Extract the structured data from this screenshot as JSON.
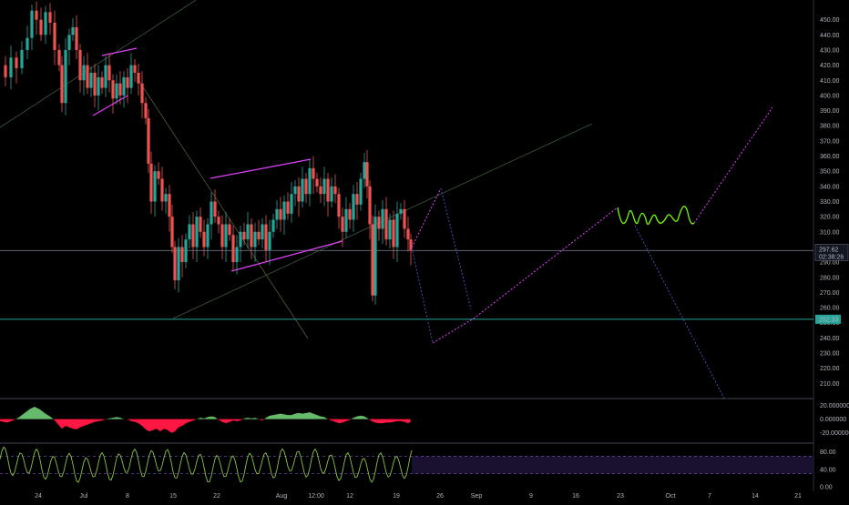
{
  "chart_data": [
    {
      "type": "candlestick",
      "pane": "price",
      "ylim": [
        200,
        457
      ],
      "y_ticks": [
        "450.00",
        "440.00",
        "430.00",
        "420.00",
        "410.00",
        "400.00",
        "390.00",
        "380.00",
        "370.00",
        "360.00",
        "350.00",
        "340.00",
        "330.00",
        "320.00",
        "310.00",
        "300.00",
        "290.00",
        "280.00",
        "270.00",
        "260.00",
        "250.00",
        "240.00",
        "230.00",
        "220.00",
        "210.00"
      ],
      "x_ticks": [
        "24",
        "Jul",
        "8",
        "15",
        "22",
        "Aug",
        "12:00",
        "12",
        "19",
        "26",
        "Sep",
        "9",
        "16",
        "23",
        "Oct",
        "7",
        "14",
        "21"
      ],
      "current_price": "297.62",
      "countdown": "02:38:26",
      "support_level": "252.33",
      "colors": {
        "up": "#26a69a",
        "down": "#ef5350",
        "background": "#000000",
        "fib_magenta": "#e040fb",
        "projection_blue": "#3f51b5",
        "support_line": "#26a69a",
        "wave_green": "#76ff03"
      },
      "price_path": [
        [
          0,
          420
        ],
        [
          6,
          412
        ],
        [
          12,
          425
        ],
        [
          18,
          418
        ],
        [
          24,
          430
        ],
        [
          30,
          438
        ],
        [
          35,
          456
        ],
        [
          40,
          450
        ],
        [
          45,
          440
        ],
        [
          50,
          455
        ],
        [
          55,
          448
        ],
        [
          60,
          430
        ],
        [
          65,
          420
        ],
        [
          68,
          395
        ],
        [
          72,
          430
        ],
        [
          76,
          440
        ],
        [
          80,
          445
        ],
        [
          84,
          430
        ],
        [
          88,
          410
        ],
        [
          92,
          420
        ],
        [
          96,
          405
        ],
        [
          100,
          415
        ],
        [
          104,
          400
        ],
        [
          108,
          412
        ],
        [
          112,
          405
        ],
        [
          116,
          420
        ],
        [
          120,
          410
        ],
        [
          124,
          398
        ],
        [
          128,
          408
        ],
        [
          132,
          400
        ],
        [
          136,
          412
        ],
        [
          140,
          405
        ],
        [
          144,
          420
        ],
        [
          148,
          415
        ],
        [
          152,
          408
        ],
        [
          156,
          395
        ],
        [
          160,
          385
        ],
        [
          163,
          355
        ],
        [
          166,
          330
        ],
        [
          170,
          350
        ],
        [
          174,
          345
        ],
        [
          178,
          330
        ],
        [
          182,
          335
        ],
        [
          186,
          320
        ],
        [
          189,
          300
        ],
        [
          192,
          278
        ],
        [
          196,
          300
        ],
        [
          200,
          290
        ],
        [
          204,
          305
        ],
        [
          208,
          315
        ],
        [
          212,
          300
        ],
        [
          216,
          320
        ],
        [
          220,
          310
        ],
        [
          224,
          300
        ],
        [
          228,
          315
        ],
        [
          232,
          330
        ],
        [
          236,
          320
        ],
        [
          240,
          315
        ],
        [
          244,
          300
        ],
        [
          248,
          315
        ],
        [
          252,
          308
        ],
        [
          256,
          290
        ],
        [
          260,
          300
        ],
        [
          264,
          310
        ],
        [
          268,
          305
        ],
        [
          272,
          315
        ],
        [
          276,
          300
        ],
        [
          280,
          310
        ],
        [
          284,
          305
        ],
        [
          288,
          315
        ],
        [
          292,
          298
        ],
        [
          296,
          310
        ],
        [
          300,
          318
        ],
        [
          304,
          325
        ],
        [
          308,
          318
        ],
        [
          312,
          330
        ],
        [
          316,
          322
        ],
        [
          320,
          335
        ],
        [
          324,
          340
        ],
        [
          328,
          330
        ],
        [
          332,
          345
        ],
        [
          336,
          335
        ],
        [
          340,
          352
        ],
        [
          344,
          345
        ],
        [
          348,
          340
        ],
        [
          352,
          335
        ],
        [
          356,
          345
        ],
        [
          360,
          330
        ],
        [
          364,
          340
        ],
        [
          368,
          335
        ],
        [
          372,
          320
        ],
        [
          376,
          310
        ],
        [
          380,
          325
        ],
        [
          384,
          318
        ],
        [
          388,
          335
        ],
        [
          392,
          328
        ],
        [
          396,
          345
        ],
        [
          400,
          356
        ],
        [
          403,
          340
        ],
        [
          406,
          315
        ],
        [
          409,
          268
        ],
        [
          412,
          320
        ],
        [
          416,
          312
        ],
        [
          420,
          325
        ],
        [
          424,
          305
        ],
        [
          428,
          318
        ],
        [
          432,
          300
        ],
        [
          436,
          322
        ],
        [
          440,
          325
        ],
        [
          444,
          312
        ],
        [
          448,
          305
        ],
        [
          451,
          298
        ]
      ],
      "macd": {
        "ylim": [
          -35,
          30
        ],
        "ticks": [
          "20.000000",
          "0.000000",
          "-20.000000"
        ],
        "hist": [
          [
            0,
            -3
          ],
          [
            8,
            -5
          ],
          [
            14,
            -2
          ],
          [
            20,
            2
          ],
          [
            26,
            8
          ],
          [
            32,
            14
          ],
          [
            38,
            18
          ],
          [
            44,
            14
          ],
          [
            50,
            8
          ],
          [
            56,
            3
          ],
          [
            60,
            -2
          ],
          [
            64,
            -8
          ],
          [
            68,
            -14
          ],
          [
            72,
            -10
          ],
          [
            76,
            -12
          ],
          [
            80,
            -14
          ],
          [
            84,
            -15
          ],
          [
            88,
            -12
          ],
          [
            92,
            -10
          ],
          [
            96,
            -8
          ],
          [
            100,
            -6
          ],
          [
            104,
            -4
          ],
          [
            108,
            -3
          ],
          [
            112,
            -2
          ],
          [
            116,
            0
          ],
          [
            120,
            1
          ],
          [
            124,
            2
          ],
          [
            128,
            3
          ],
          [
            132,
            2
          ],
          [
            136,
            0
          ],
          [
            140,
            0
          ],
          [
            144,
            -3
          ],
          [
            148,
            -4
          ],
          [
            152,
            -6
          ],
          [
            156,
            -10
          ],
          [
            160,
            -15
          ],
          [
            164,
            -18
          ],
          [
            168,
            -16
          ],
          [
            172,
            -14
          ],
          [
            176,
            -18
          ],
          [
            180,
            -14
          ],
          [
            184,
            -16
          ],
          [
            188,
            -20
          ],
          [
            192,
            -18
          ],
          [
            196,
            -12
          ],
          [
            200,
            -10
          ],
          [
            204,
            -6
          ],
          [
            208,
            -4
          ],
          [
            212,
            -2
          ],
          [
            216,
            0
          ],
          [
            220,
            2
          ],
          [
            224,
            1
          ],
          [
            228,
            3
          ],
          [
            232,
            4
          ],
          [
            236,
            3
          ],
          [
            240,
            -1
          ],
          [
            244,
            -4
          ],
          [
            248,
            -6
          ],
          [
            252,
            -4
          ],
          [
            256,
            -2
          ],
          [
            260,
            -3
          ],
          [
            264,
            -2
          ],
          [
            268,
            1
          ],
          [
            272,
            2
          ],
          [
            276,
            1
          ],
          [
            280,
            2
          ],
          [
            284,
            0
          ],
          [
            288,
            -2
          ],
          [
            292,
            2
          ],
          [
            296,
            5
          ],
          [
            300,
            6
          ],
          [
            304,
            7
          ],
          [
            308,
            8
          ],
          [
            312,
            7
          ],
          [
            316,
            6
          ],
          [
            320,
            6
          ],
          [
            324,
            8
          ],
          [
            328,
            9
          ],
          [
            332,
            8
          ],
          [
            336,
            9
          ],
          [
            340,
            10
          ],
          [
            344,
            8
          ],
          [
            348,
            6
          ],
          [
            352,
            4
          ],
          [
            356,
            3
          ],
          [
            360,
            0
          ],
          [
            364,
            -2
          ],
          [
            368,
            -4
          ],
          [
            372,
            -6
          ],
          [
            376,
            -5
          ],
          [
            380,
            -3
          ],
          [
            384,
            -1
          ],
          [
            388,
            2
          ],
          [
            392,
            4
          ],
          [
            396,
            5
          ],
          [
            400,
            4
          ],
          [
            404,
            1
          ],
          [
            408,
            -3
          ],
          [
            412,
            -5
          ],
          [
            416,
            -6
          ],
          [
            420,
            -6
          ],
          [
            424,
            -5
          ],
          [
            428,
            -5
          ],
          [
            432,
            -4
          ],
          [
            436,
            -3
          ],
          [
            440,
            -3
          ],
          [
            444,
            -4
          ],
          [
            448,
            -6
          ],
          [
            451,
            -4
          ]
        ]
      },
      "oscillator": {
        "ylim": [
          0,
          100
        ],
        "ticks": [
          "80.00",
          "40.00",
          "0.00"
        ]
      }
    }
  ]
}
